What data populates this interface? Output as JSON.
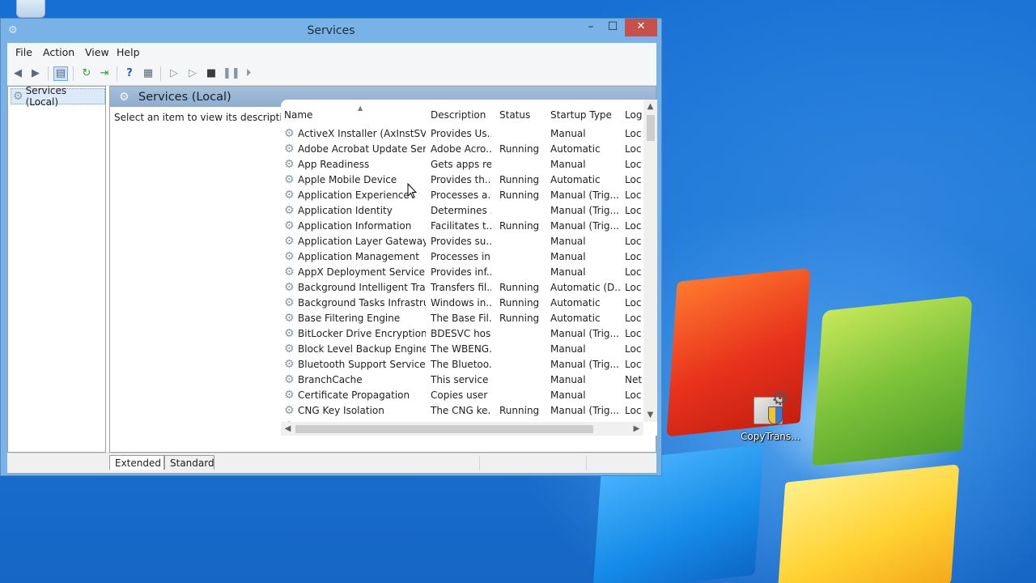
{
  "desktop": {
    "icons": [
      {
        "name": "recycle-bin-icon",
        "label": ""
      },
      {
        "name": "copytrans-icon",
        "label": "CopyTrans..."
      }
    ]
  },
  "window": {
    "title": "Services",
    "controls": {
      "minimize": "–",
      "maximize": "☐",
      "close": "✕"
    }
  },
  "menu": [
    "File",
    "Action",
    "View",
    "Help"
  ],
  "toolbar": {
    "icons": [
      "back-icon",
      "forward-icon",
      "show-hide-console-tree-icon",
      "refresh-icon",
      "export-list-icon",
      "help-icon",
      "properties-icon",
      "start-service-icon",
      "start-service-alt-icon",
      "stop-service-icon",
      "pause-service-icon",
      "restart-service-icon"
    ]
  },
  "tree": {
    "item": "Services (Local)"
  },
  "pane": {
    "title": "Services (Local)",
    "description": "Select an item to view its description."
  },
  "table": {
    "columns": [
      "Name",
      "Description",
      "Status",
      "Startup Type",
      "Log"
    ],
    "rows": [
      {
        "name": "ActiveX Installer (AxInstSV)",
        "desc": "Provides Us...",
        "status": "",
        "startup": "Manual",
        "log": "Loc"
      },
      {
        "name": "Adobe Acrobat Update Serv...",
        "desc": "Adobe Acro...",
        "status": "Running",
        "startup": "Automatic",
        "log": "Loc"
      },
      {
        "name": "App Readiness",
        "desc": "Gets apps re...",
        "status": "",
        "startup": "Manual",
        "log": "Loc"
      },
      {
        "name": "Apple Mobile Device",
        "desc": "Provides th...",
        "status": "Running",
        "startup": "Automatic",
        "log": "Loc"
      },
      {
        "name": "Application Experience",
        "desc": "Processes a...",
        "status": "Running",
        "startup": "Manual (Trig...",
        "log": "Loc"
      },
      {
        "name": "Application Identity",
        "desc": "Determines ...",
        "status": "",
        "startup": "Manual (Trig...",
        "log": "Loc"
      },
      {
        "name": "Application Information",
        "desc": "Facilitates t...",
        "status": "Running",
        "startup": "Manual (Trig...",
        "log": "Loc"
      },
      {
        "name": "Application Layer Gateway ...",
        "desc": "Provides su...",
        "status": "",
        "startup": "Manual",
        "log": "Loc"
      },
      {
        "name": "Application Management",
        "desc": "Processes in...",
        "status": "",
        "startup": "Manual",
        "log": "Loc"
      },
      {
        "name": "AppX Deployment Service (...",
        "desc": "Provides inf...",
        "status": "",
        "startup": "Manual",
        "log": "Loc"
      },
      {
        "name": "Background Intelligent Tran...",
        "desc": "Transfers fil...",
        "status": "Running",
        "startup": "Automatic (D...",
        "log": "Loc"
      },
      {
        "name": "Background Tasks Infrastru...",
        "desc": "Windows in...",
        "status": "Running",
        "startup": "Automatic",
        "log": "Loc"
      },
      {
        "name": "Base Filtering Engine",
        "desc": "The Base Fil...",
        "status": "Running",
        "startup": "Automatic",
        "log": "Loc"
      },
      {
        "name": "BitLocker Drive Encryption ...",
        "desc": "BDESVC hos...",
        "status": "",
        "startup": "Manual (Trig...",
        "log": "Loc"
      },
      {
        "name": "Block Level Backup Engine ...",
        "desc": "The WBENG...",
        "status": "",
        "startup": "Manual",
        "log": "Loc"
      },
      {
        "name": "Bluetooth Support Service",
        "desc": "The Bluetoo...",
        "status": "",
        "startup": "Manual (Trig...",
        "log": "Loc"
      },
      {
        "name": "BranchCache",
        "desc": "This service ...",
        "status": "",
        "startup": "Manual",
        "log": "Net"
      },
      {
        "name": "Certificate Propagation",
        "desc": "Copies user ...",
        "status": "",
        "startup": "Manual",
        "log": "Loc"
      },
      {
        "name": "CNG Key Isolation",
        "desc": "The CNG ke...",
        "status": "Running",
        "startup": "Manual (Trig...",
        "log": "Loc"
      }
    ]
  },
  "tabs": [
    "Extended",
    "Standard"
  ]
}
